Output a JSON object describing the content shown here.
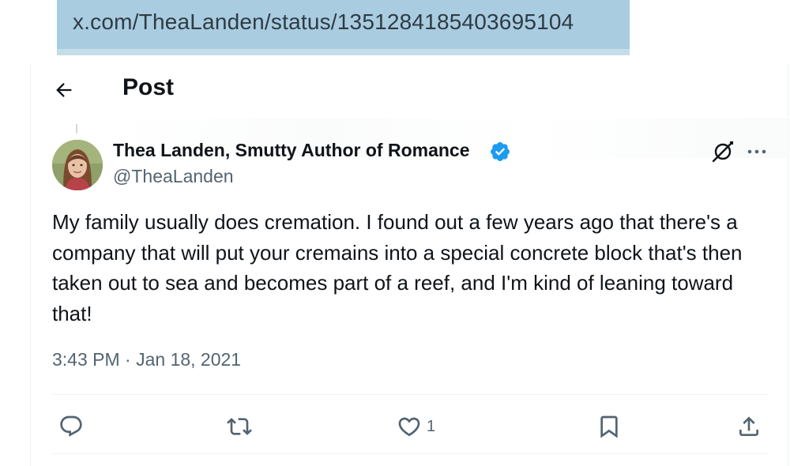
{
  "browser": {
    "url": "x.com/TheaLanden/status/1351284185403695104"
  },
  "header": {
    "title": "Post"
  },
  "tweet": {
    "author_name": "Thea Landen, Smutty Author of Romance",
    "handle": "@TheaLanden",
    "text": "My family usually does cremation. I found out a few years ago that there's a company that will put your cremains into a special concrete block that's then taken out to sea and becomes part of a reef, and I'm kind of leaning toward that!",
    "timestamp": "3:43 PM · Jan 18, 2021",
    "likes": "1"
  },
  "icons": {
    "back": "arrow-left-icon",
    "verified": "verified-badge-icon",
    "grok": "grok-icon",
    "more": "more-dots-icon",
    "reply": "reply-icon",
    "repost": "repost-icon",
    "like": "heart-icon",
    "bookmark": "bookmark-icon",
    "share": "share-icon"
  },
  "colors": {
    "url_bar": "#a9cce0",
    "verified": "#1d9bf0",
    "secondary_text": "#536471",
    "icon": "#536471"
  }
}
